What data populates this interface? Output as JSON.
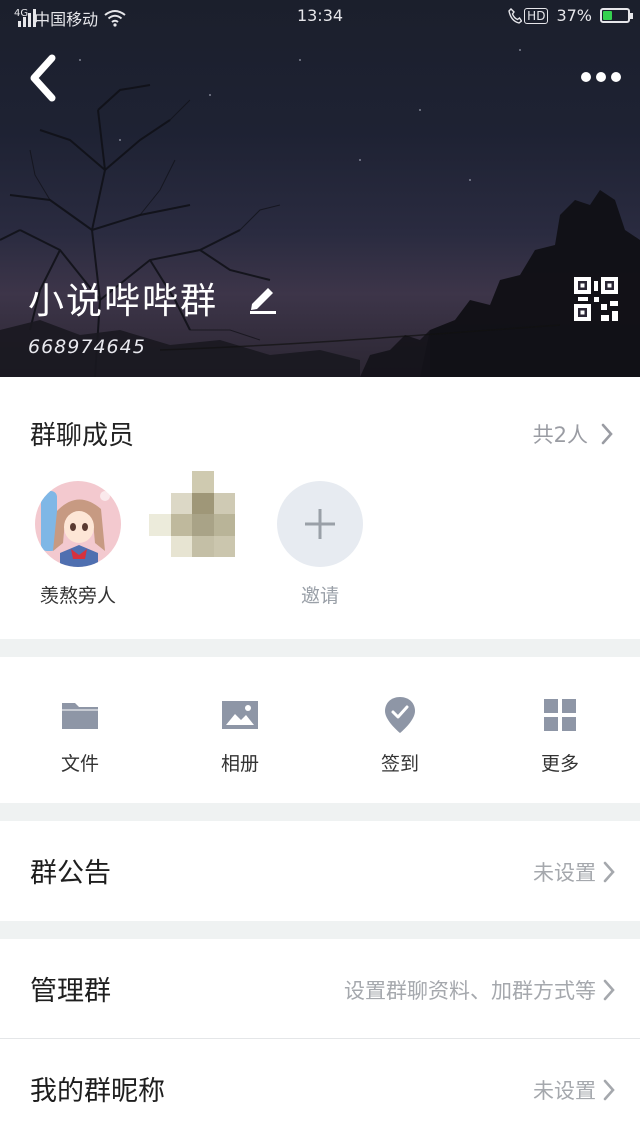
{
  "status_bar": {
    "network": "4G",
    "carrier": "中国移动",
    "time": "13:34",
    "hd": "HD",
    "battery_text": "37%",
    "battery_level": 0.37
  },
  "header": {
    "back_icon": "chevron-left-icon",
    "more_icon": "more-horizontal-icon",
    "group_name": "小说哔哔群",
    "edit_icon": "pencil-icon",
    "group_id": "668974645",
    "qr_icon": "qr-code-icon"
  },
  "members": {
    "title": "群聊成员",
    "count_text": "共2人",
    "list": [
      {
        "name": "羡熬旁人",
        "avatar": "anime-girl-avatar"
      },
      {
        "name": "",
        "avatar": "pixelated-avatar"
      }
    ],
    "invite_label": "邀请"
  },
  "actions": [
    {
      "label": "文件",
      "icon": "folder-icon"
    },
    {
      "label": "相册",
      "icon": "image-icon"
    },
    {
      "label": "签到",
      "icon": "checkin-badge-icon"
    },
    {
      "label": "更多",
      "icon": "grid-icon"
    }
  ],
  "rows": {
    "announcement": {
      "label": "群公告",
      "value": "未设置"
    },
    "manage": {
      "label": "管理群",
      "value": "设置群聊资料、加群方式等"
    },
    "nickname": {
      "label": "我的群昵称",
      "value": "未设置"
    }
  },
  "colors": {
    "accent_icon": "#8e96a6",
    "muted_text": "#a5a8ad",
    "section_gap": "#eff2f2",
    "battery_green": "#35d14f"
  }
}
